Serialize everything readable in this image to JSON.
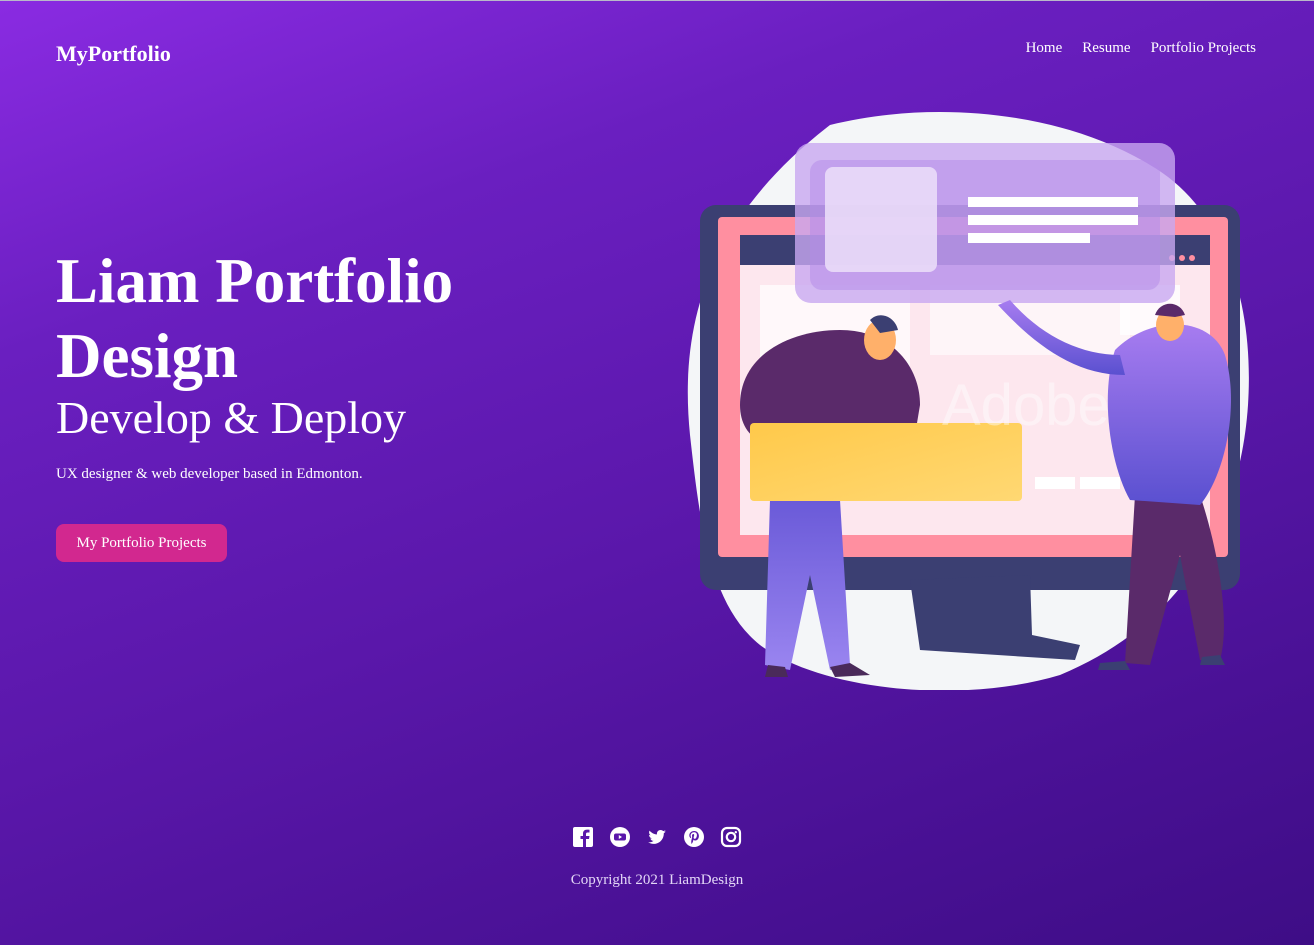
{
  "header": {
    "logo": "MyPortfolio",
    "nav": [
      "Home",
      "Resume",
      "Portfolio Projects"
    ]
  },
  "hero": {
    "title_line1": "Liam Portfolio",
    "title_line2": "Design",
    "subtitle": "Develop & Deploy",
    "description": "UX designer & web developer based in Edmonton.",
    "cta_label": "My Portfolio Projects"
  },
  "illustration": {
    "watermark": "Adobe"
  },
  "footer": {
    "social_icons": [
      "facebook-icon",
      "youtube-icon",
      "twitter-icon",
      "pinterest-icon",
      "instagram-icon"
    ],
    "copyright": "Copyright 2021 LiamDesign"
  },
  "colors": {
    "cta": "#d2288f",
    "background_top": "#8a2be2",
    "background_bottom": "#3e0d86"
  }
}
